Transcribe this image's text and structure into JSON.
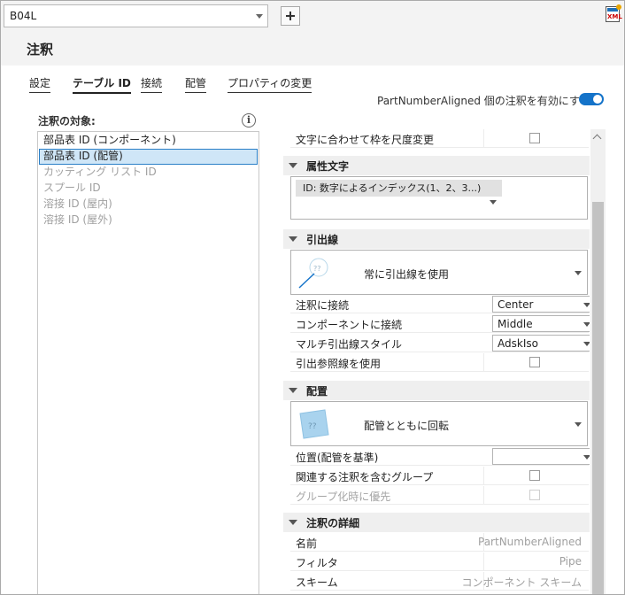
{
  "header": {
    "combo_value": "B04L",
    "add_label": "",
    "title": "注釈"
  },
  "tabs": [
    {
      "label": "設定",
      "active": false
    },
    {
      "label": "テーブル ID",
      "active": true
    },
    {
      "label": "接続",
      "active": false
    },
    {
      "label": "配管",
      "active": false
    },
    {
      "label": "プロパティの変更",
      "active": false
    }
  ],
  "enable": {
    "label": "PartNumberAligned 個の注釈を有効にする:",
    "on": true
  },
  "targets": {
    "label": "注釈の対象:",
    "items": [
      {
        "label": "部品表 ID (コンポーネント)",
        "state": "normal"
      },
      {
        "label": "部品表 ID (配管)",
        "state": "selected"
      },
      {
        "label": "カッティング リスト ID",
        "state": "disabled"
      },
      {
        "label": "スプール ID",
        "state": "disabled"
      },
      {
        "label": "溶接 ID (屋内)",
        "state": "disabled"
      },
      {
        "label": "溶接 ID (屋外)",
        "state": "disabled"
      }
    ]
  },
  "props": {
    "scale_to_text": {
      "label": "文字に合わせて枠を尺度変更",
      "checked": false
    },
    "attribute_text": {
      "title": "属性文字",
      "chip": "ID: 数字によるインデックス(1、2、3...)"
    },
    "leader": {
      "title": "引出線",
      "mode": "常に引出線を使用",
      "rows": [
        {
          "label": "注釈に接続",
          "value": "Center"
        },
        {
          "label": "コンポーネントに接続",
          "value": "Middle"
        },
        {
          "label": "マルチ引出線スタイル",
          "value": "AdskIso"
        }
      ],
      "use_reference": {
        "label": "引出参照線を使用",
        "checked": false
      }
    },
    "placement": {
      "title": "配置",
      "mode": "配管とともに回転",
      "position_label": "位置(配管を基準)",
      "position_value": "",
      "group_related": {
        "label": "関連する注釈を含むグループ",
        "checked": false
      },
      "group_priority": {
        "label": "グループ化時に優先",
        "checked": false
      }
    },
    "details": {
      "title": "注釈の詳細",
      "rows": [
        {
          "label": "名前",
          "value": "PartNumberAligned"
        },
        {
          "label": "フィルタ",
          "value": "Pipe"
        },
        {
          "label": "スキーム",
          "value": "コンポーネント スキーム"
        }
      ]
    }
  },
  "icons": {
    "combo_arrow": "chevron-down-icon",
    "add": "plus-icon",
    "app": "app-icon",
    "info": "info-icon",
    "section_toggle": "collapse-triangle-icon",
    "leader_preview": "leader-preview-icon",
    "rotate_preview": "rotate-preview-icon"
  },
  "colors": {
    "accent": "#1473c9",
    "selection": "#cfe6f7",
    "section_bg": "#efefef",
    "disabled_text": "#a0a0a0"
  }
}
